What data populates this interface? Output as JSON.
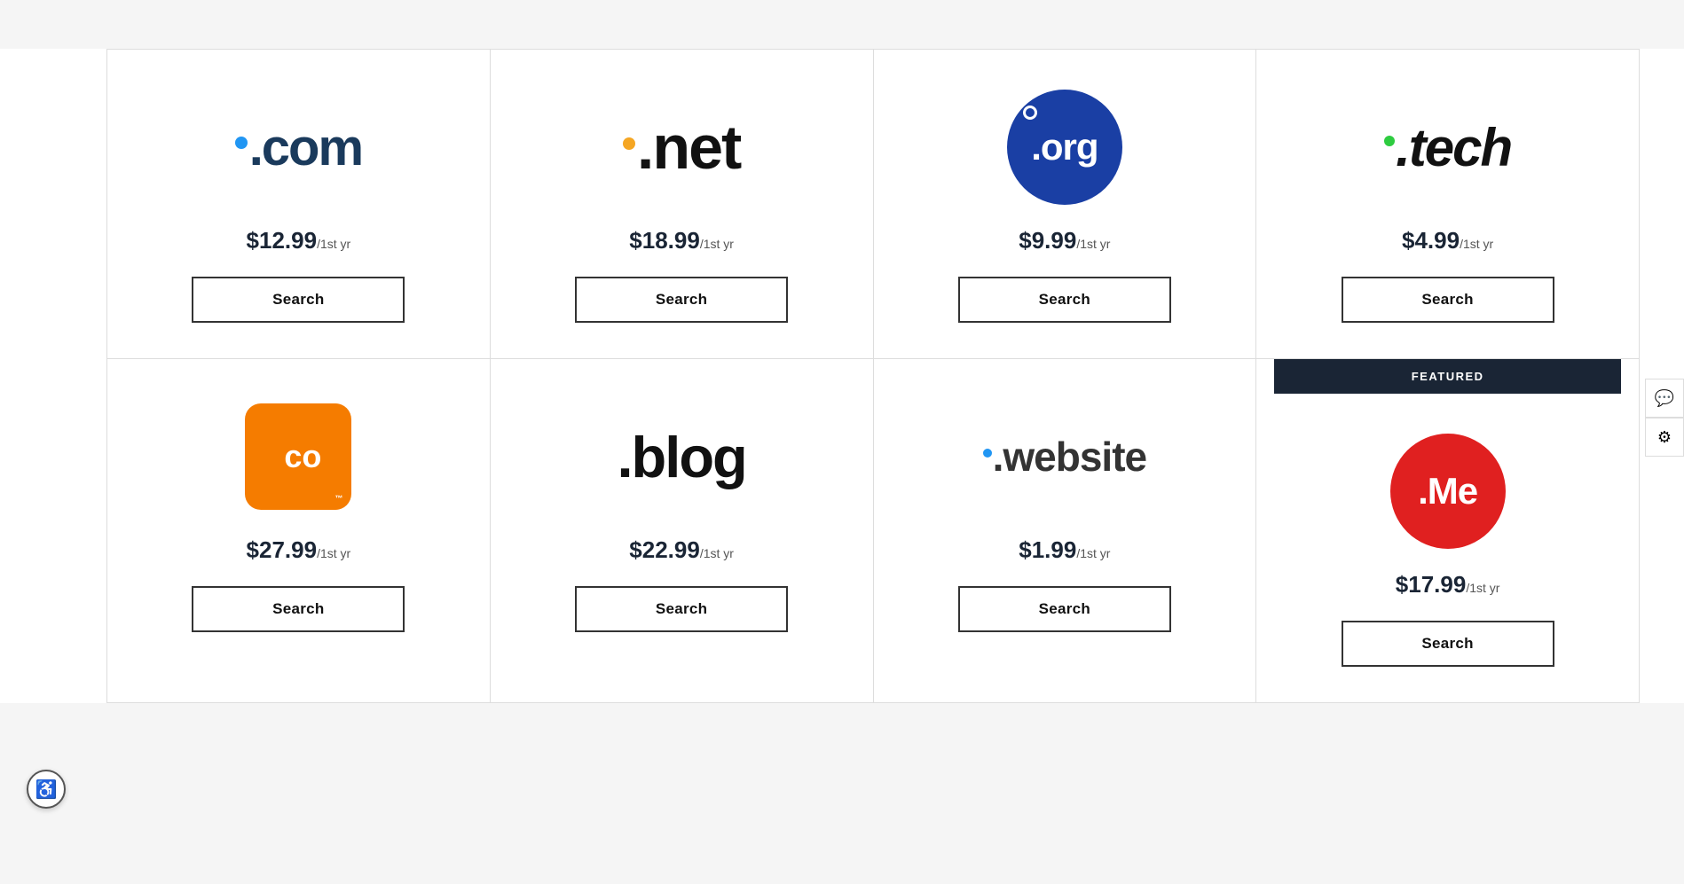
{
  "grid": {
    "row1": [
      {
        "id": "com",
        "type": "com",
        "price": "$12.99",
        "per_yr": "/1st yr",
        "search_label": "Search",
        "featured": false
      },
      {
        "id": "net",
        "type": "net",
        "price": "$18.99",
        "per_yr": "/1st yr",
        "search_label": "Search",
        "featured": false
      },
      {
        "id": "org",
        "type": "org",
        "price": "$9.99",
        "per_yr": "/1st yr",
        "search_label": "Search",
        "featured": false
      },
      {
        "id": "tech",
        "type": "tech",
        "price": "$4.99",
        "per_yr": "/1st yr",
        "search_label": "Search",
        "featured": false
      }
    ],
    "row2": [
      {
        "id": "co",
        "type": "co",
        "price": "$27.99",
        "per_yr": "/1st yr",
        "search_label": "Search",
        "featured": false
      },
      {
        "id": "blog",
        "type": "blog",
        "price": "$22.99",
        "per_yr": "/1st yr",
        "search_label": "Search",
        "featured": false
      },
      {
        "id": "website",
        "type": "website",
        "price": "$1.99",
        "per_yr": "/1st yr",
        "search_label": "Search",
        "featured": false
      },
      {
        "id": "me",
        "type": "me",
        "price": "$17.99",
        "per_yr": "/1st yr",
        "search_label": "Search",
        "featured": true,
        "featured_label": "FEATURED"
      }
    ]
  },
  "sidebar": {
    "chat_icon": "💬",
    "settings_icon": "⚙"
  },
  "accessibility": {
    "icon": "♿"
  }
}
